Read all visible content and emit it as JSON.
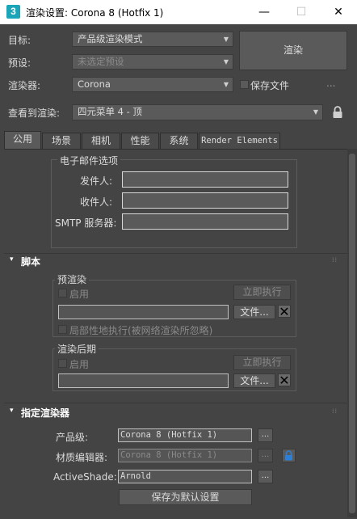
{
  "window": {
    "icon_label": "3",
    "title": "渲染设置: Corona 8 (Hotfix 1)",
    "minimize": "—",
    "maximize": "☐",
    "close": "✕"
  },
  "top": {
    "target_label": "目标:",
    "target_value": "产品级渲染模式",
    "preset_label": "预设:",
    "preset_value": "未选定预设",
    "renderer_label": "渲染器:",
    "renderer_value": "Corona",
    "render_button": "渲染",
    "save_file_label": "保存文件",
    "ellipsis": "...",
    "view_label": "查看到渲染:",
    "view_value": "四元菜单 4 - 顶"
  },
  "tabs": [
    "公用",
    "场景",
    "相机",
    "性能",
    "系统",
    "Render Elements"
  ],
  "email": {
    "group_label": "电子邮件选项",
    "from_label": "发件人:",
    "from_value": "",
    "to_label": "收件人:",
    "to_value": "",
    "smtp_label": "SMTP 服务器:",
    "smtp_value": ""
  },
  "scripts": {
    "header": "脚本",
    "pre_group": "预渲染",
    "pre_enable": "启用",
    "pre_run": "立即执行",
    "pre_file": "文件...",
    "pre_path": "",
    "local_exec": "局部性地执行(被网络渲染所忽略)",
    "post_group": "渲染后期",
    "post_enable": "启用",
    "post_run": "立即执行",
    "post_file": "文件...",
    "post_path": "",
    "remove_icon": "✕"
  },
  "assign": {
    "header": "指定渲染器",
    "production_label": "产品级:",
    "production_value": "Corona 8 (Hotfix 1)",
    "material_label": "材质编辑器:",
    "material_value": "Corona 8 (Hotfix 1)",
    "activeshade_label": "ActiveShade:",
    "activeshade_value": "Arnold",
    "browse": "...",
    "save_default": "保存为默认设置"
  },
  "icons": {
    "collapse": "▾",
    "combo_arrow": "▼",
    "grip": "⁞⁞"
  },
  "colors": {
    "background": "#444444",
    "titlebar": "#ffffff",
    "app_icon": "#1ba5b8",
    "lock_icon": "#2b7fd6"
  }
}
